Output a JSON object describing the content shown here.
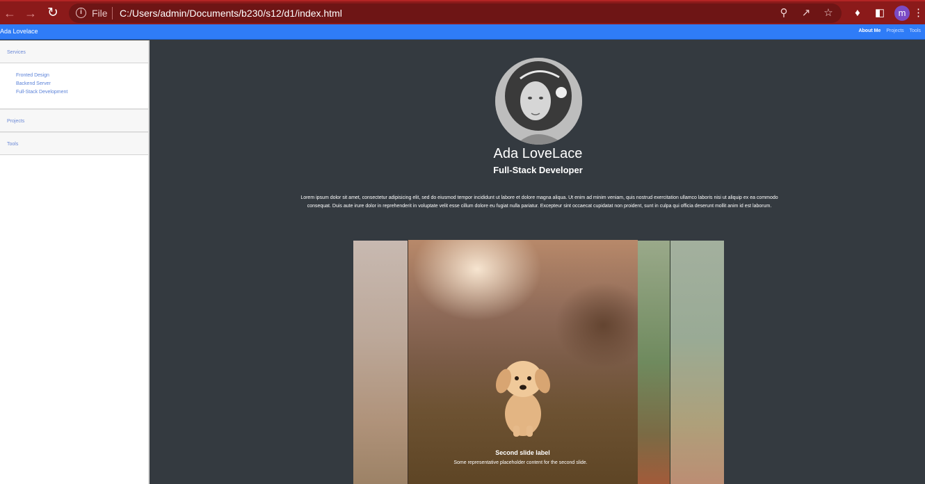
{
  "browser": {
    "scheme_label": "File",
    "url": "C:/Users/admin/Documents/b230/s12/d1/index.html",
    "profile_initial": "m",
    "theme_color": "#8b1a1a"
  },
  "navbar": {
    "brand": "Ada Lovelace",
    "links": [
      {
        "label": "About Me",
        "active": true
      },
      {
        "label": "Projects",
        "active": false
      },
      {
        "label": "Tools",
        "active": false
      }
    ],
    "color": "#2f7cf7"
  },
  "sidebar": {
    "sections": [
      {
        "label": "Services",
        "items": [
          "Fronted Design",
          "Backend Server",
          "Full-Stack Development"
        ]
      },
      {
        "label": "Projects",
        "items": []
      },
      {
        "label": "Tools",
        "items": []
      }
    ]
  },
  "profile": {
    "name": "Ada LoveLace",
    "title": "Full-Stack Developer",
    "bio": "Lorem ipsum dolor sit amet, consectetur adipisicing elit, sed do eiusmod tempor incididunt ut labore et dolore magna aliqua. Ut enim ad minim veniam, quis nostrud exercitation ullamco laboris nisi ut aliquip ex ea commodo consequat. Duis aute irure dolor in reprehenderit in voluptate velit esse cillum dolore eu fugiat nulla pariatur. Excepteur sint occaecat cupidatat non proident, sunt in culpa qui officia deserunt mollit anim id est laborum."
  },
  "carousel": {
    "caption_title": "Second slide label",
    "caption_text": "Some representative placeholder content for the second slide."
  }
}
